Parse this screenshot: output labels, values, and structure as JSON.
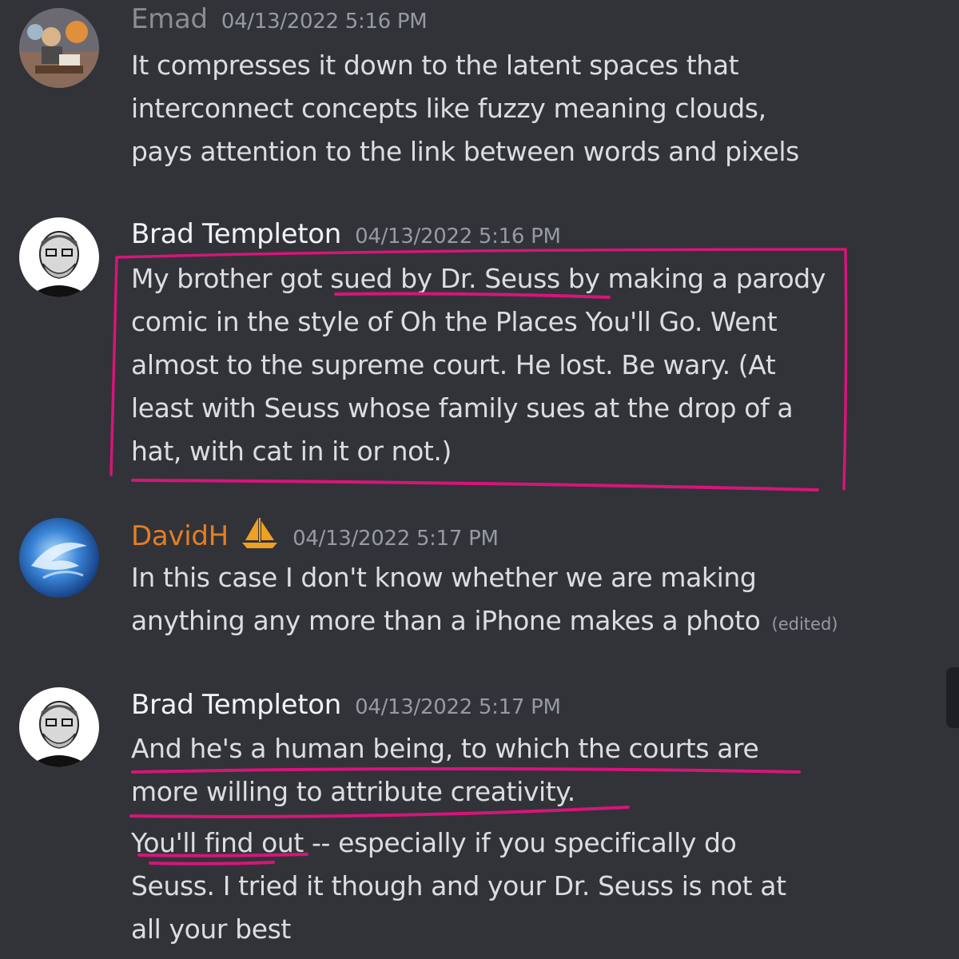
{
  "messages": [
    {
      "username": "Emad",
      "timestamp": "04/13/2022 5:16 PM",
      "lines": [
        "It compresses it down to the latent spaces that",
        "interconnect concepts like fuzzy meaning clouds,",
        "pays attention to the link between words and pixels"
      ]
    },
    {
      "username": "Brad Templeton",
      "timestamp": "04/13/2022 5:16 PM",
      "lines": [
        "My brother got sued by Dr. Seuss by making a parody",
        "comic in the style of Oh the Places You'll Go.   Went",
        "almost to the supreme court.  He lost.  Be wary.  (At",
        "least with Seuss whose family sues at the drop of a",
        "hat, with cat in it or not.)"
      ]
    },
    {
      "username": "DavidH",
      "timestamp": "04/13/2022 5:17 PM",
      "badge_icon": "sailboat-icon",
      "lines": [
        "In this case I don't know whether we are making",
        "anything any more than a iPhone makes a photo"
      ],
      "edited_label": "(edited)"
    },
    {
      "username": "Brad Templeton",
      "timestamp": "04/13/2022 5:17 PM",
      "lines": [
        "And he's a human being, to which the courts are",
        "more willing to attribute creativity.",
        "You'll find out -- especially if you specifically do",
        "Seuss.    I tried it though and your Dr. Seuss is not at",
        "all your best"
      ]
    }
  ],
  "colors": {
    "background": "#313338",
    "text": "#dbdee1",
    "timestamp": "#949ba4",
    "davidh_name": "#e67e22",
    "annotation_pink": "#d6157a"
  }
}
